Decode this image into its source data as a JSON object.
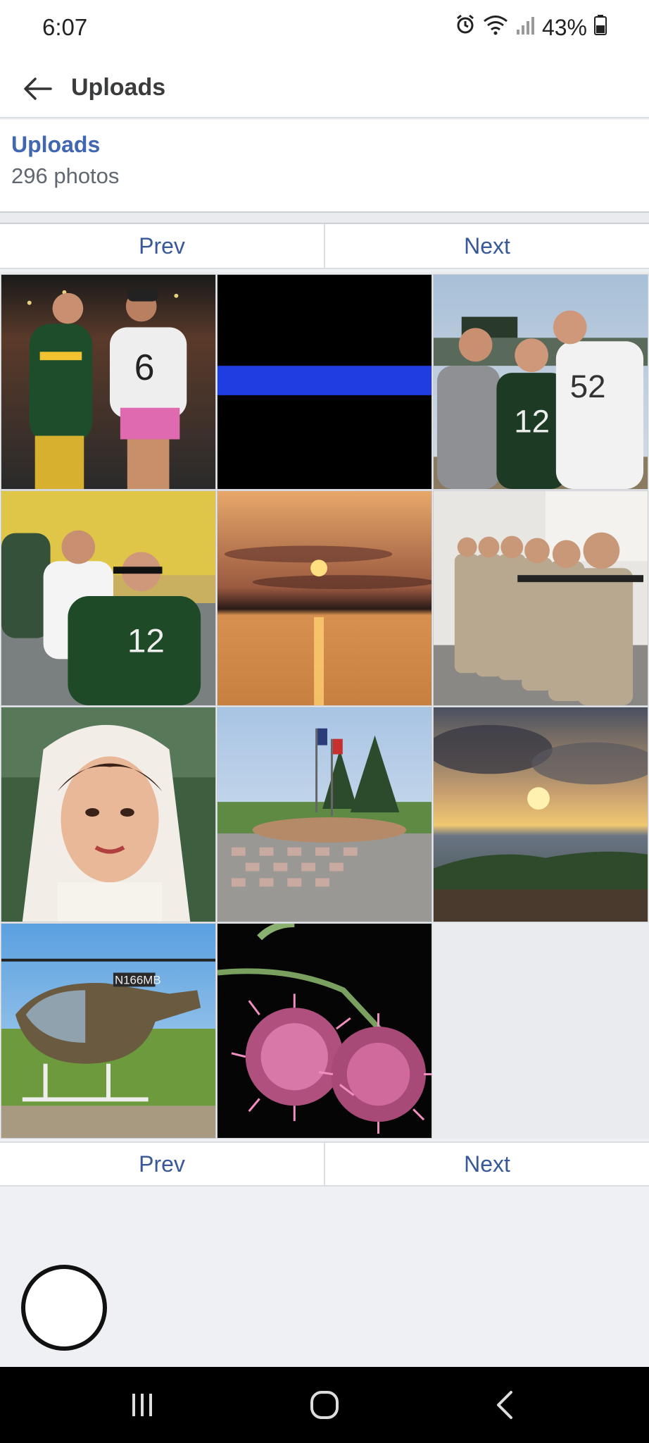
{
  "status_bar": {
    "time": "6:07",
    "battery": "43%",
    "icons": [
      "alarm-icon",
      "wifi-icon",
      "signal-icon",
      "battery-icon"
    ]
  },
  "app_bar": {
    "title": "Uploads",
    "back_icon": "back-arrow-icon"
  },
  "album": {
    "name": "Uploads",
    "count": "296 photos"
  },
  "pager": {
    "prev_label": "Prev",
    "next_label": "Next"
  },
  "photos": [
    {
      "subject": "football players at stadium"
    },
    {
      "subject": "thin blue line flag"
    },
    {
      "subject": "three men at Lambeau Field"
    },
    {
      "subject": "fans in stands"
    },
    {
      "subject": "sunset over lake"
    },
    {
      "subject": "soldiers with rifles"
    },
    {
      "subject": "vintage bride portrait"
    },
    {
      "subject": "memorial plaza with flags"
    },
    {
      "subject": "beach sunset"
    },
    {
      "subject": "helicopter",
      "text": "N166MB"
    },
    {
      "subject": "pink rambutan flowers"
    }
  ],
  "colors": {
    "link_blue": "#4267b2",
    "pager_text": "#385898",
    "background": "#eef0f4"
  },
  "nav_bar": {
    "icons": [
      "recents-icon",
      "home-icon",
      "back-icon"
    ]
  }
}
